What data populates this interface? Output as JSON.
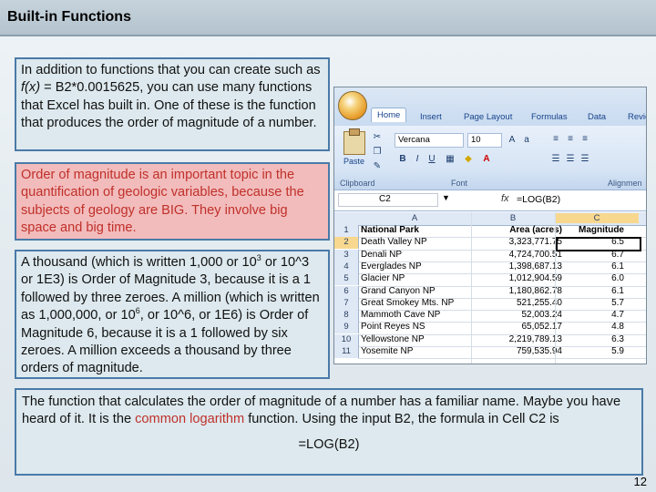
{
  "slide": {
    "title": "Built-in Functions",
    "page_number": "12"
  },
  "box1": {
    "line_a": "In addition to functions that you can create such as ",
    "fx": "f(x)",
    "line_b": " = B2*0.0015625, you can use many functions that Excel has built in.  One of these is the function that produces the order of magnitude of a number."
  },
  "box2": {
    "text": "Order of magnitude is an important topic in the quantification of geologic variables, because the subjects of geology are BIG.  They involve big space and big time."
  },
  "box3": {
    "p1": "A thousand (which is written 1,000 or 10",
    "sup1": "3",
    "p2": " or 10^3 or 1E3) is Order of Magnitude 3, because it is a 1 followed by three zeroes.  A million (which is written as 1,000,000, or 10",
    "sup2": "6",
    "p3": ", or 10^6, or 1E6) is Order of Magnitude 6, because it is a 1 followed by six zeroes.  A million exceeds a thousand by three orders of magnitude."
  },
  "box4": {
    "p1": "The function that calculates the order of magnitude of a number has a familiar name.  Maybe you have heard of it.  It is the ",
    "highlight": "common logarithm",
    "p2": " function.  Using the input B2, the formula in Cell C2 is",
    "formula": "=LOG(B2)"
  },
  "excel": {
    "tabs": [
      "Home",
      "Insert",
      "Page Layout",
      "Formulas",
      "Data",
      "Review"
    ],
    "font_name": "Vercana",
    "font_size": "10",
    "group_labels": [
      "Clipboard",
      "Font",
      "Alignmen"
    ],
    "paste_label": "Paste",
    "name_box": "C2",
    "fx_label": "fx",
    "formula": "=LOG(B2)",
    "columns": [
      "A",
      "B",
      "C"
    ],
    "rows": [
      {
        "num": "1",
        "a": "National Park",
        "b": "Area (acres)",
        "c": "Magnitude"
      },
      {
        "num": "2",
        "a": "Death Valley NP",
        "b": "3,323,771.75",
        "c": "6.5"
      },
      {
        "num": "3",
        "a": "Denali NP",
        "b": "4,724,700.51",
        "c": "6.7"
      },
      {
        "num": "4",
        "a": "Everglades NP",
        "b": "1,398,687.13",
        "c": "6.1"
      },
      {
        "num": "5",
        "a": "Glacier NP",
        "b": "1,012,904.59",
        "c": "6.0"
      },
      {
        "num": "6",
        "a": "Grand Canyon NP",
        "b": "1,180,862.78",
        "c": "6.1"
      },
      {
        "num": "7",
        "a": "Great Smokey Mts. NP",
        "b": "521,255.40",
        "c": "5.7"
      },
      {
        "num": "8",
        "a": "Mammoth Cave NP",
        "b": "52,003.24",
        "c": "4.7"
      },
      {
        "num": "9",
        "a": "Point Reyes NS",
        "b": "65,052.17",
        "c": "4.8"
      },
      {
        "num": "10",
        "a": "Yellowstone NP",
        "b": "2,219,789.13",
        "c": "6.3"
      },
      {
        "num": "11",
        "a": "Yosemite NP",
        "b": "759,535.94",
        "c": "5.9"
      }
    ]
  }
}
